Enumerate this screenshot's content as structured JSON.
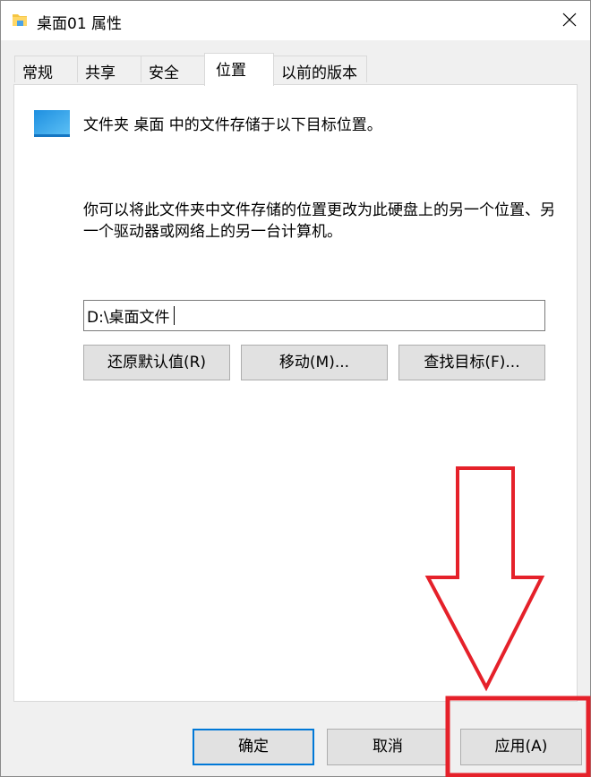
{
  "window": {
    "title": "桌面01 属性"
  },
  "tabs": [
    {
      "label": "常规"
    },
    {
      "label": "共享"
    },
    {
      "label": "安全"
    },
    {
      "label": "位置"
    },
    {
      "label": "以前的版本"
    }
  ],
  "panel": {
    "description_1": "文件夹 桌面 中的文件存储于以下目标位置。",
    "description_2": "你可以将此文件夹中文件存储的位置更改为此硬盘上的另一个位置、另一个驱动器或网络上的另一台计算机。",
    "path_value": "D:\\桌面文件",
    "restore_default_label": "还原默认值(R)",
    "move_label": "移动(M)...",
    "find_target_label": "查找目标(F)..."
  },
  "footer": {
    "ok_label": "确定",
    "cancel_label": "取消",
    "apply_label": "应用(A)"
  },
  "annotation": {
    "color": "#e5212a"
  },
  "colors": {
    "accent": "#0078d7",
    "folder": "#f5c542"
  }
}
